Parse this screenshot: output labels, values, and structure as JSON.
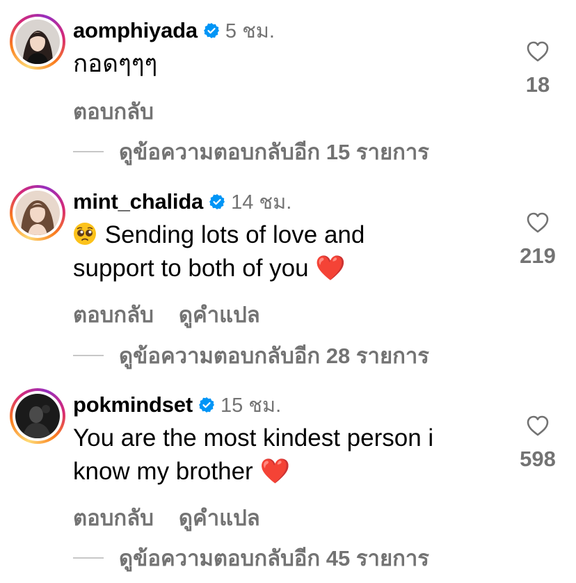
{
  "colors": {
    "secondary_text": "#737373",
    "verified_blue": "#0095f6",
    "heart_red": "#e0202e",
    "reply_line": "#c7c7c7"
  },
  "comments": [
    {
      "username": "aomphiyada",
      "time": "5 ชม.",
      "text": "กอดๆๆๆ",
      "actions": [
        "ตอบกลับ"
      ],
      "view_replies": "ดูข้อความตอบกลับอีก 15 รายการ",
      "likes": "18",
      "verified": true
    },
    {
      "username": "mint_chalida",
      "time": "14 ชม.",
      "text": "Sending lots of love and\nsupport to both of you",
      "leading_emoji": "pleading-face-emoji",
      "trailing_emoji": "❤️",
      "actions": [
        "ตอบกลับ",
        "ดูคำแปล"
      ],
      "view_replies": "ดูข้อความตอบกลับอีก 28 รายการ",
      "likes": "219",
      "verified": true
    },
    {
      "username": "pokmindset",
      "time": "15 ชม.",
      "text": "You are the most kindest person i\nknow my brother",
      "trailing_emoji": "❤️",
      "actions": [
        "ตอบกลับ",
        "ดูคำแปล"
      ],
      "view_replies": "ดูข้อความตอบกลับอีก 45 รายการ",
      "likes": "598",
      "verified": true
    }
  ]
}
